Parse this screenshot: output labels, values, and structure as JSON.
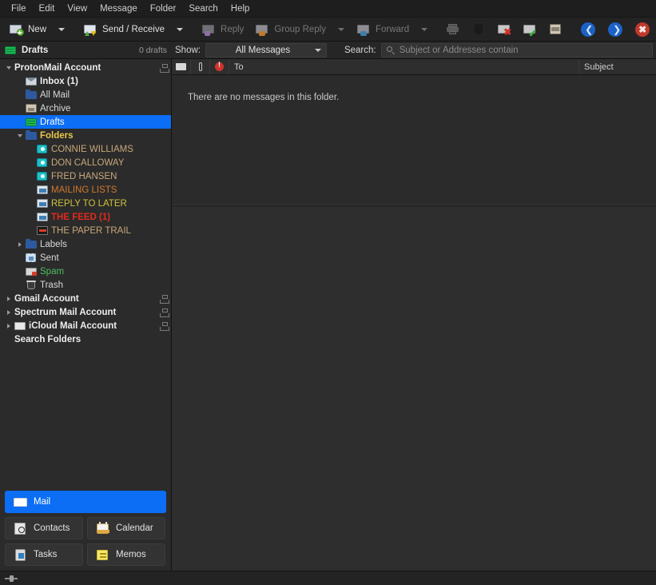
{
  "menubar": {
    "items": [
      {
        "label": "File"
      },
      {
        "label": "Edit"
      },
      {
        "label": "View"
      },
      {
        "label": "Message"
      },
      {
        "label": "Folder"
      },
      {
        "label": "Search"
      },
      {
        "label": "Help"
      }
    ]
  },
  "toolbar": {
    "new_label": "New",
    "send_receive_label": "Send / Receive",
    "reply_label": "Reply",
    "group_reply_label": "Group Reply",
    "forward_label": "Forward",
    "print_icon": "printer-icon",
    "delete_icon": "trash-icon",
    "junk_icon": "mark-as-junk-icon",
    "not_junk_icon": "mark-as-not-junk-icon",
    "archive_icon": "archive-icon",
    "back_icon": "back-arrow-icon",
    "forward_nav_icon": "forward-arrow-icon",
    "close_icon": "close-icon"
  },
  "filterbar": {
    "folder_name": "Drafts",
    "count_text": "0 drafts",
    "show_label": "Show:",
    "show_value": "All Messages",
    "search_label": "Search:",
    "search_placeholder": "Subject or Addresses contain",
    "search_value": ""
  },
  "sidebar": {
    "items": [
      {
        "label": "ProtonMail Account",
        "type": "account",
        "indent": 0,
        "twisty": "down",
        "icon": "none",
        "color": "#ededed",
        "bold": true,
        "net": true,
        "selected": false
      },
      {
        "label": "Inbox (1)",
        "type": "folder",
        "indent": 1,
        "twisty": "none",
        "icon": "envelope",
        "color": "#ededed",
        "bold": true,
        "net": false,
        "selected": false
      },
      {
        "label": "All Mail",
        "type": "folder",
        "indent": 1,
        "twisty": "none",
        "icon": "folder",
        "color": "#d9d9d9",
        "bold": false,
        "net": false,
        "selected": false
      },
      {
        "label": "Archive",
        "type": "folder",
        "indent": 1,
        "twisty": "none",
        "icon": "archive",
        "color": "#d9d9d9",
        "bold": false,
        "net": false,
        "selected": false
      },
      {
        "label": "Drafts",
        "type": "folder",
        "indent": 1,
        "twisty": "none",
        "icon": "drafts",
        "color": "#ffffff",
        "bold": false,
        "net": false,
        "selected": true
      },
      {
        "label": "Folders",
        "type": "group",
        "indent": 1,
        "twisty": "down",
        "icon": "folder",
        "color": "#e8c84a",
        "bold": true,
        "net": false,
        "selected": false
      },
      {
        "label": "CONNIE WILLIAMS",
        "type": "folder",
        "indent": 2,
        "twisty": "none",
        "icon": "avatar",
        "color": "#c9a87a",
        "bold": false,
        "net": false,
        "selected": false
      },
      {
        "label": "DON CALLOWAY",
        "type": "folder",
        "indent": 2,
        "twisty": "none",
        "icon": "avatar",
        "color": "#c9a87a",
        "bold": false,
        "net": false,
        "selected": false
      },
      {
        "label": "FRED HANSEN",
        "type": "folder",
        "indent": 2,
        "twisty": "none",
        "icon": "avatar",
        "color": "#c9a87a",
        "bold": false,
        "net": false,
        "selected": false
      },
      {
        "label": "MAILING LISTS",
        "type": "folder",
        "indent": 2,
        "twisty": "none",
        "icon": "list",
        "color": "#d2792c",
        "bold": false,
        "net": false,
        "selected": false
      },
      {
        "label": "REPLY TO LATER",
        "type": "folder",
        "indent": 2,
        "twisty": "none",
        "icon": "list",
        "color": "#cfc23a",
        "bold": false,
        "net": false,
        "selected": false
      },
      {
        "label": "THE FEED (1)",
        "type": "folder",
        "indent": 2,
        "twisty": "none",
        "icon": "list",
        "color": "#e02b1d",
        "bold": true,
        "net": false,
        "selected": false
      },
      {
        "label": "THE PAPER TRAIL",
        "type": "folder",
        "indent": 2,
        "twisty": "none",
        "icon": "paper",
        "color": "#c9a87a",
        "bold": false,
        "net": false,
        "selected": false
      },
      {
        "label": "Labels",
        "type": "group",
        "indent": 1,
        "twisty": "right",
        "icon": "folder",
        "color": "#d9d9d9",
        "bold": false,
        "net": false,
        "selected": false
      },
      {
        "label": "Sent",
        "type": "folder",
        "indent": 1,
        "twisty": "none",
        "icon": "sent",
        "color": "#d9d9d9",
        "bold": false,
        "net": false,
        "selected": false
      },
      {
        "label": "Spam",
        "type": "folder",
        "indent": 1,
        "twisty": "none",
        "icon": "spam",
        "color": "#4fbf5f",
        "bold": false,
        "net": false,
        "selected": false
      },
      {
        "label": "Trash",
        "type": "folder",
        "indent": 1,
        "twisty": "none",
        "icon": "trash",
        "color": "#d9d9d9",
        "bold": false,
        "net": false,
        "selected": false
      },
      {
        "label": "Gmail Account",
        "type": "account",
        "indent": 0,
        "twisty": "right",
        "icon": "none",
        "color": "#ededed",
        "bold": true,
        "net": true,
        "selected": false
      },
      {
        "label": "Spectrum Mail Account",
        "type": "account",
        "indent": 0,
        "twisty": "right",
        "icon": "none",
        "color": "#ededed",
        "bold": true,
        "net": true,
        "selected": false
      },
      {
        "label": "iCloud Mail Account",
        "type": "account",
        "indent": 0,
        "twisty": "right",
        "icon": "blank",
        "color": "#ededed",
        "bold": true,
        "net": true,
        "selected": false
      },
      {
        "label": "Search Folders",
        "type": "account",
        "indent": 0,
        "twisty": "none",
        "icon": "none",
        "color": "#ededed",
        "bold": true,
        "net": false,
        "selected": false
      }
    ]
  },
  "modules": [
    {
      "label": "Mail",
      "icon": "mail-icon",
      "active": true,
      "width": "full"
    },
    {
      "label": "Contacts",
      "icon": "contacts-icon",
      "active": false,
      "width": "half"
    },
    {
      "label": "Calendar",
      "icon": "calendar-icon",
      "active": false,
      "width": "half"
    },
    {
      "label": "Tasks",
      "icon": "tasks-icon",
      "active": false,
      "width": "half"
    },
    {
      "label": "Memos",
      "icon": "memos-icon",
      "active": false,
      "width": "half"
    }
  ],
  "messagelist": {
    "columns": {
      "read_icon": "envelope-icon",
      "attachment_icon": "paperclip-icon",
      "priority_icon": "priority-icon",
      "to": "To",
      "subject": "Subject"
    },
    "empty_text": "There are no messages in this folder.",
    "rows": []
  },
  "colors": {
    "accent": "#0b6ef5",
    "window_bg": "#2b2b2b",
    "toolbar_bg": "#232323",
    "folder_yellow": "#e8c84a",
    "folder_red": "#e02b1d",
    "folder_green": "#4fbf5f",
    "folder_orange": "#d2792c"
  }
}
